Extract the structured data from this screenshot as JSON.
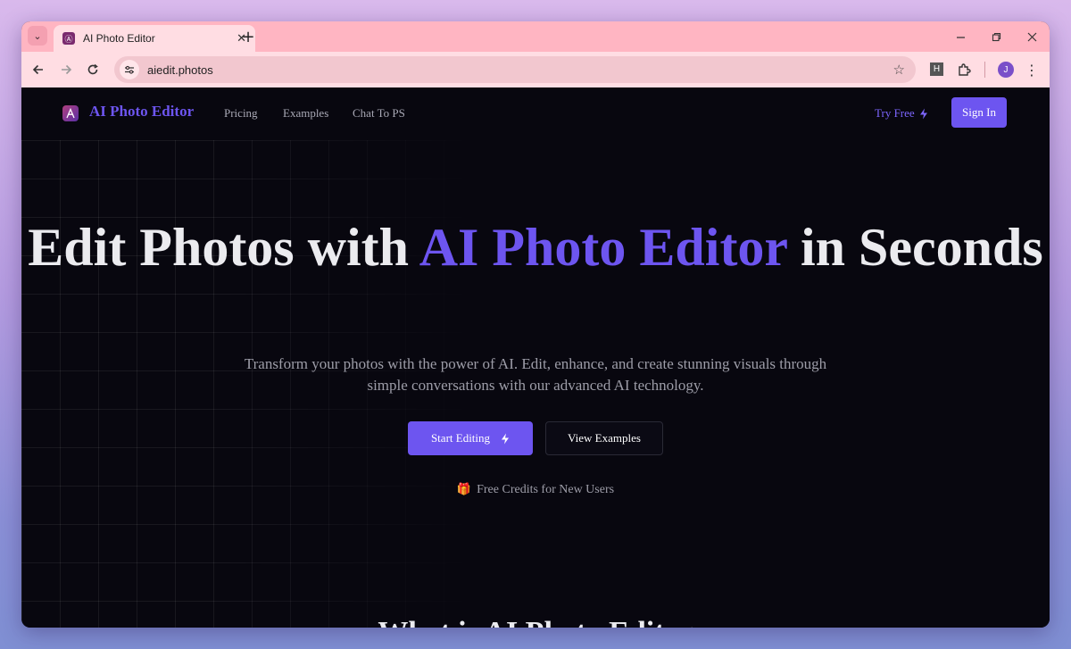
{
  "browser": {
    "tab_title": "AI Photo Editor",
    "tab_close": "✕",
    "new_tab": "+",
    "url": "aiedit.photos",
    "profile_initial": "J",
    "extension_letter": "H",
    "icons": {
      "tab_search": "chevron-down-icon",
      "back": "arrow-left-icon",
      "forward": "arrow-right-icon",
      "reload": "reload-icon",
      "bookmark": "star-icon",
      "extensions": "puzzle-icon",
      "menu": "kebab-menu-icon"
    }
  },
  "nav": {
    "brand": "AI Photo Editor",
    "links": [
      "Pricing",
      "Examples",
      "Chat To PS"
    ],
    "try_free": "Try Free",
    "sign_in": "Sign In"
  },
  "hero": {
    "title_part1": "Edit Photos with ",
    "title_accent": "AI Photo Editor",
    "title_part2": " in Seconds",
    "subtitle": "Transform your photos with the power of AI. Edit, enhance, and create stunning visuals through simple conversations with our advanced AI technology.",
    "primary_button": "Start Editing",
    "secondary_button": "View Examples",
    "credits_note": "Free Credits for New Users"
  },
  "next_section": {
    "heading": "What is AI Photo Editor"
  },
  "colors": {
    "accent": "#6d55f0",
    "page_background": "#08070f",
    "tab_strip": "#ffb5c2"
  }
}
